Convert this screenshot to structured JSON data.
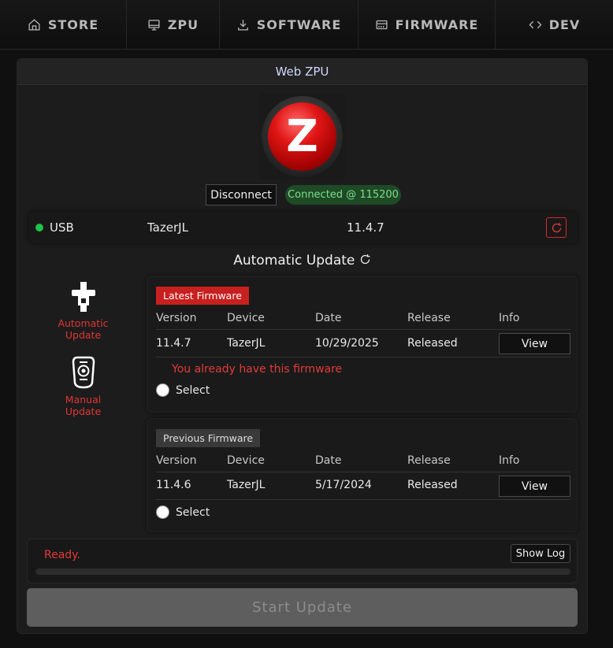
{
  "nav": {
    "items": [
      {
        "label": "STORE",
        "icon": "home-icon"
      },
      {
        "label": "ZPU",
        "icon": "monitor-icon"
      },
      {
        "label": "SOFTWARE",
        "icon": "download-icon"
      },
      {
        "label": "FIRMWARE",
        "icon": "chip-icon"
      },
      {
        "label": "DEV",
        "icon": "code-icon"
      }
    ]
  },
  "card": {
    "title": "Web ZPU",
    "logo_letter": "Z"
  },
  "connection": {
    "disconnect_label": "Disconnect",
    "status": "Connected @ 115200",
    "status_color": "#1f4a26"
  },
  "device": {
    "interface": "USB",
    "name": "TazerJL",
    "version": "11.4.7"
  },
  "update": {
    "title": "Automatic Update",
    "modes": [
      {
        "label": "Automatic Update",
        "icon": "usb-stick-icon"
      },
      {
        "label": "Manual Update",
        "icon": "device-remote-icon"
      }
    ]
  },
  "table_headers": [
    "Version",
    "Device",
    "Date",
    "Release",
    "Info"
  ],
  "latest": {
    "tag": "Latest Firmware",
    "row": {
      "version": "11.4.7",
      "device": "TazerJL",
      "date": "10/29/2025",
      "release": "Released"
    },
    "view_label": "View",
    "warning": "You already have this firmware",
    "select_label": "Select"
  },
  "previous": {
    "tag": "Previous Firmware",
    "row": {
      "version": "11.4.6",
      "device": "TazerJL",
      "date": "5/17/2024",
      "release": "Released"
    },
    "view_label": "View",
    "select_label": "Select"
  },
  "status": {
    "text": "Ready.",
    "show_log_label": "Show Log",
    "progress_percent": 0
  },
  "start_label": "Start Update",
  "colors": {
    "accent_red": "#c81f1f",
    "connected_green": "#1fc24a"
  }
}
